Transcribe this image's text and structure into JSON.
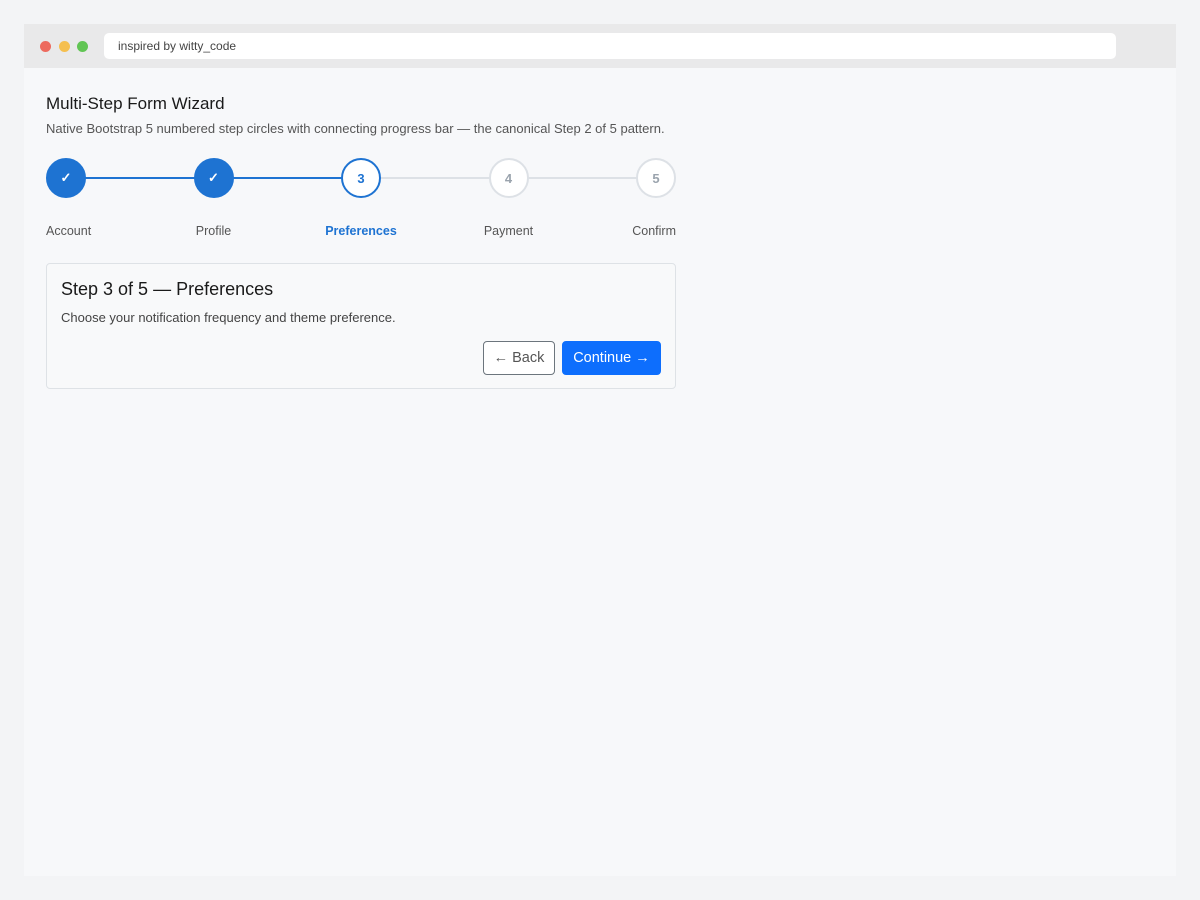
{
  "browser": {
    "address": "inspired by witty_code",
    "traffic_lights": {
      "close": "#ed6a5e",
      "minimize": "#f5bf4f",
      "zoom": "#61c554"
    }
  },
  "page": {
    "title": "Multi-Step Form Wizard",
    "subtitle": "Native Bootstrap 5 numbered step circles with connecting progress bar — the canonical Step 2 of 5 pattern."
  },
  "stepper": {
    "current_step": 3,
    "total_steps": 5,
    "progress_fraction": 0.5,
    "steps": [
      {
        "number": "1",
        "label": "Account",
        "status": "completed",
        "glyph": "✓"
      },
      {
        "number": "2",
        "label": "Profile",
        "status": "completed",
        "glyph": "✓"
      },
      {
        "number": "3",
        "label": "Preferences",
        "status": "active",
        "glyph": "3"
      },
      {
        "number": "4",
        "label": "Payment",
        "status": "upcoming",
        "glyph": "4"
      },
      {
        "number": "5",
        "label": "Confirm",
        "status": "upcoming",
        "glyph": "5"
      }
    ]
  },
  "card": {
    "title": "Step 3 of 5 — Preferences",
    "text": "Choose your notification frequency and theme preference.",
    "back_label": "← Back",
    "continue_label": "Continue →"
  },
  "colors": {
    "primary": "#1e73d2",
    "button_primary": "#0d6efd",
    "track_inactive": "#dde1e6"
  }
}
